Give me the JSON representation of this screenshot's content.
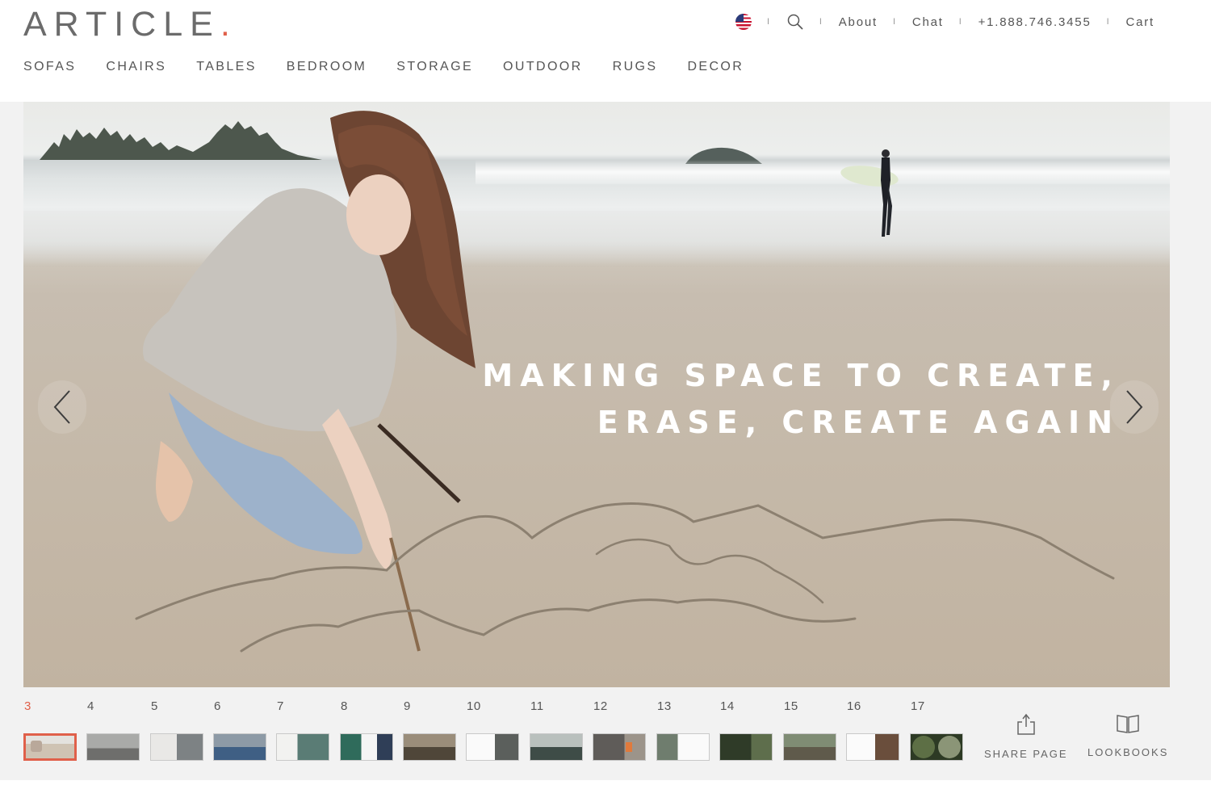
{
  "brand": {
    "logo_text": "ARTICLE",
    "logo_dot": ".",
    "accent_color": "#e0604a"
  },
  "utility_nav": {
    "flag_icon": "us-flag-icon",
    "search_icon": "search-icon",
    "separator": "I",
    "about": "About",
    "chat": "Chat",
    "phone": "+1.888.746.3455",
    "cart": "Cart"
  },
  "main_nav": [
    "SOFAS",
    "CHAIRS",
    "TABLES",
    "BEDROOM",
    "STORAGE",
    "OUTDOOR",
    "RUGS",
    "DECOR"
  ],
  "hero": {
    "headline_line1": "MAKING SPACE TO CREATE,",
    "headline_line2": "ERASE, CREATE AGAIN",
    "prev_icon": "chevron-left-icon",
    "next_icon": "chevron-right-icon"
  },
  "pagination": {
    "active_page": "3",
    "pages": [
      "3",
      "4",
      "5",
      "6",
      "7",
      "8",
      "9",
      "10",
      "11",
      "12",
      "13",
      "14",
      "15",
      "16",
      "17"
    ]
  },
  "actions": {
    "share_label": "SHARE PAGE",
    "share_icon": "share-icon",
    "lookbooks_label": "LOOKBOOKS",
    "lookbooks_icon": "book-icon"
  }
}
